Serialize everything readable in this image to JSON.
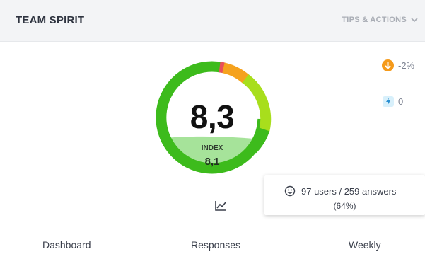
{
  "header": {
    "title": "TEAM SPIRIT",
    "tips_label": "TIPS & ACTIONS"
  },
  "gauge": {
    "score": "8,3",
    "index_label": "INDEX",
    "index_value": "8,1",
    "colors": {
      "green_dark": "#3dbb1c",
      "green_light": "#a8de1c",
      "orange": "#f5a21e",
      "red": "#e8505b",
      "fill": "#a6e39a"
    }
  },
  "stats": {
    "change_text": "-2%",
    "bolt_text": "0",
    "change_icon": "arrow-down-icon",
    "bolt_icon": "bolt-icon"
  },
  "tooltip": {
    "line1": "97 users / 259 answers",
    "line2": "(64%)",
    "icon": "smiley-icon"
  },
  "tabs": [
    {
      "label": "Dashboard"
    },
    {
      "label": "Responses"
    },
    {
      "label": "Weekly"
    }
  ]
}
